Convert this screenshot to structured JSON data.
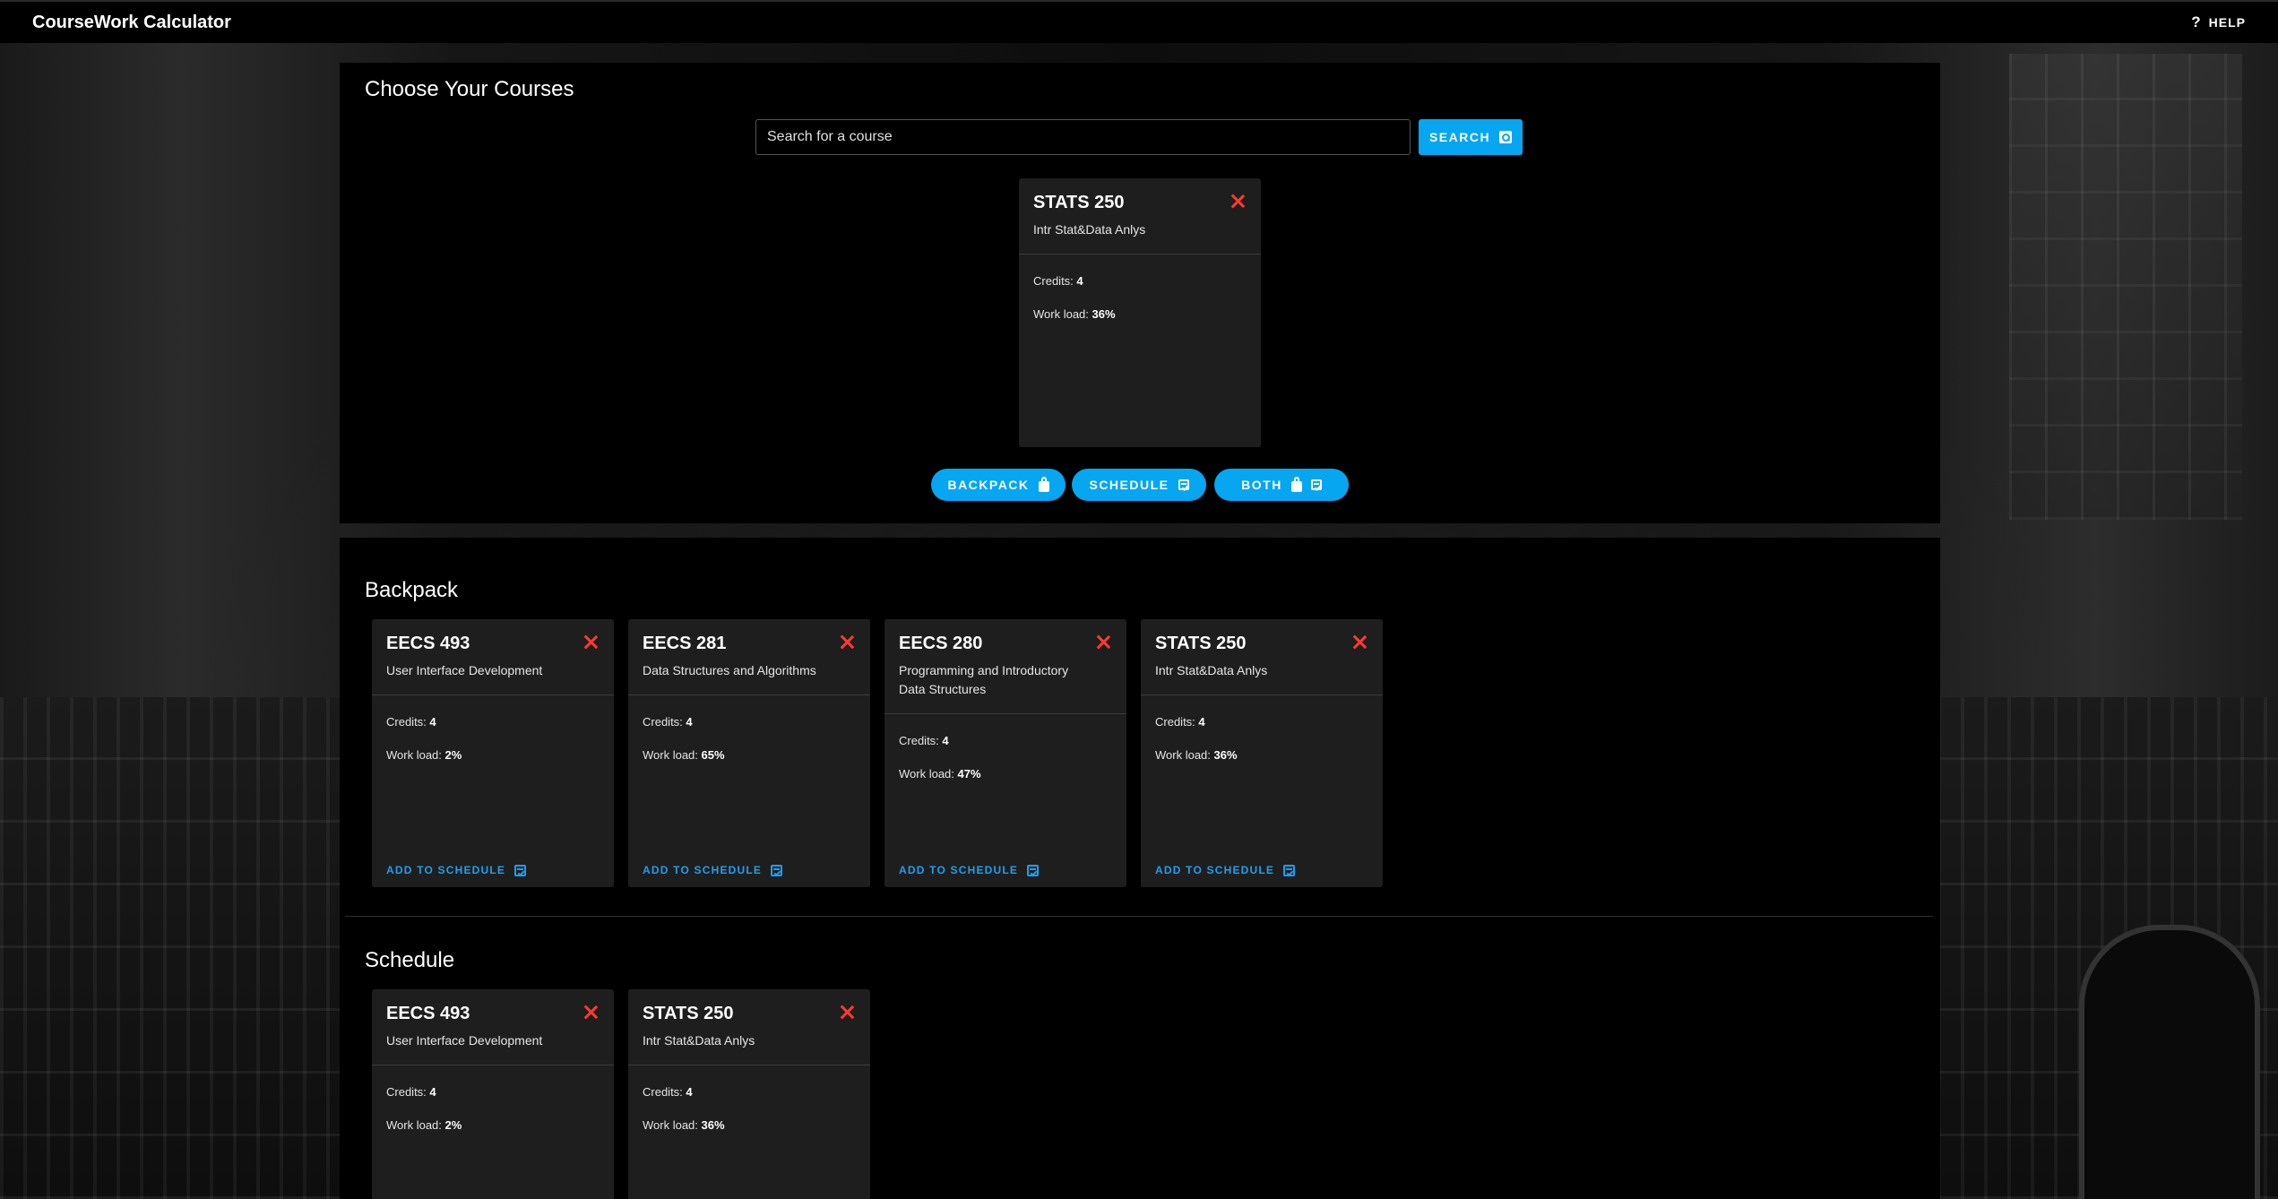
{
  "app": {
    "title": "CourseWork Calculator",
    "help_label": "HELP"
  },
  "choose": {
    "title": "Choose Your Courses",
    "search_placeholder": "Search for a course",
    "search_button": "SEARCH",
    "selected": {
      "code": "STATS 250",
      "name": "Intr Stat&Data Anlys",
      "credits_label": "Credits:",
      "credits": "4",
      "workload_label": "Work load:",
      "workload": "36%"
    },
    "actions": {
      "backpack": "BACKPACK",
      "schedule": "SCHEDULE",
      "both": "BOTH"
    }
  },
  "backpack": {
    "title": "Backpack",
    "action_label": "ADD TO SCHEDULE",
    "items": [
      {
        "code": "EECS 493",
        "name": "User Interface Development",
        "credits": "4",
        "workload": "2%"
      },
      {
        "code": "EECS 281",
        "name": "Data Structures and Algorithms",
        "credits": "4",
        "workload": "65%"
      },
      {
        "code": "EECS 280",
        "name": "Programming and Introductory Data Structures",
        "credits": "4",
        "workload": "47%"
      },
      {
        "code": "STATS 250",
        "name": "Intr Stat&Data Anlys",
        "credits": "4",
        "workload": "36%"
      }
    ]
  },
  "schedule": {
    "title": "Schedule",
    "items": [
      {
        "code": "EECS 493",
        "name": "User Interface Development",
        "credits": "4",
        "workload": "2%"
      },
      {
        "code": "STATS 250",
        "name": "Intr Stat&Data Anlys",
        "credits": "4",
        "workload": "36%"
      }
    ]
  },
  "labels": {
    "credits": "Credits:",
    "workload": "Work load:"
  },
  "colors": {
    "accent": "#06a6f1",
    "close": "#ff3b30",
    "card": "#1e1e1e"
  },
  "icons": {
    "help": "help-icon",
    "search": "search-icon",
    "close": "close-icon",
    "backpack": "backpack-icon",
    "calendar": "calendar-icon"
  }
}
